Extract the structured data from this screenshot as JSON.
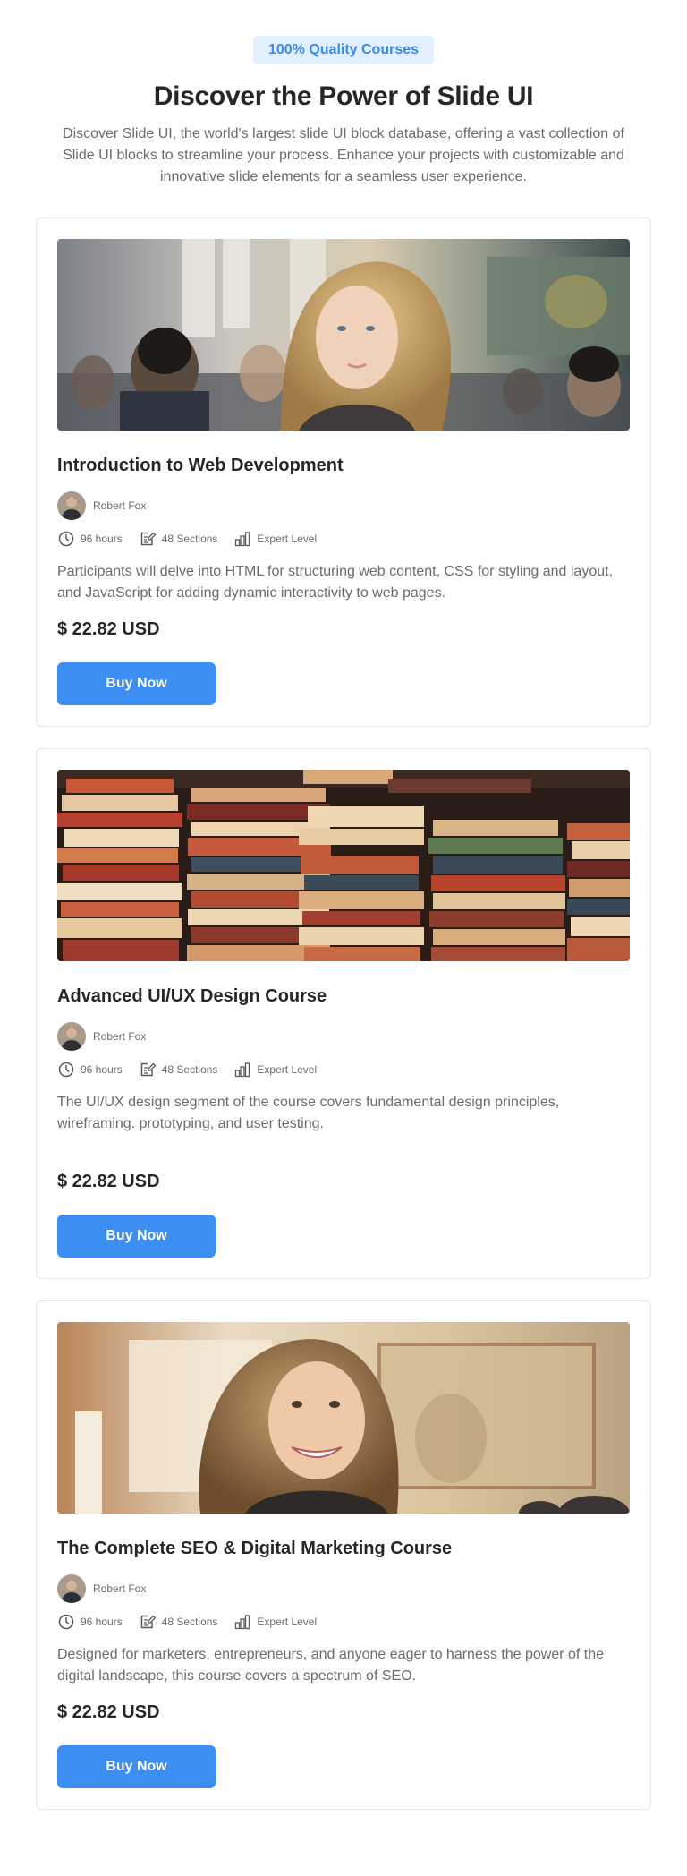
{
  "hero": {
    "badge": "100% Quality Courses",
    "title": "Discover the Power of Slide UI",
    "description": "Discover Slide UI, the world's largest slide UI block database, offering a vast collection of Slide UI blocks to streamline your process. Enhance your projects with customizable and innovative slide elements for a seamless user experience."
  },
  "colors": {
    "accent": "#3c8ef3",
    "badge_bg": "#e1efff",
    "badge_text": "#3b8ae6"
  },
  "courses": [
    {
      "title": "Introduction to Web Development",
      "author": "Robert Fox",
      "duration": "96 hours",
      "sections": "48 Sections",
      "level": "Expert Level",
      "description": "Participants will delve into HTML for structuring web content, CSS for styling and layout, and JavaScript for adding dynamic interactivity to web pages.",
      "price": "$ 22.82 USD",
      "button": "Buy Now"
    },
    {
      "title": "Advanced UI/UX Design Course",
      "author": "Robert Fox",
      "duration": "96 hours",
      "sections": "48 Sections",
      "level": "Expert Level",
      "description": "The UI/UX design segment of the course covers fundamental design principles, wireframing. prototyping, and user testing.",
      "price": "$ 22.82 USD",
      "button": "Buy Now"
    },
    {
      "title": "The Complete SEO & Digital Marketing Course",
      "author": "Robert Fox",
      "duration": "96 hours",
      "sections": "48 Sections",
      "level": "Expert Level",
      "description": "Designed for marketers, entrepreneurs, and anyone eager to harness the power of the digital landscape, this course covers a spectrum of SEO.",
      "price": "$ 22.82 USD",
      "button": "Buy Now"
    }
  ],
  "icons": [
    "clock-icon",
    "sections-icon",
    "level-bars-icon"
  ]
}
